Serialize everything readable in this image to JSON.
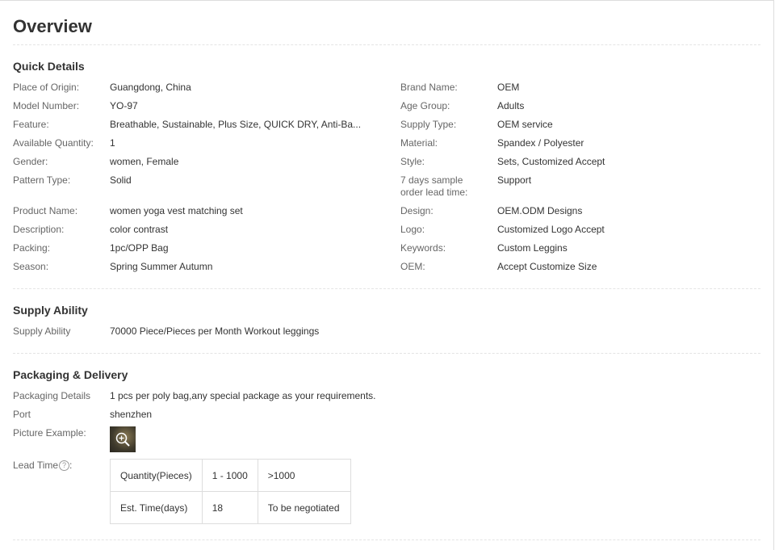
{
  "page": {
    "title": "Overview"
  },
  "quick_details": {
    "heading": "Quick Details",
    "left": [
      {
        "label": "Place of Origin:",
        "value": "Guangdong, China"
      },
      {
        "label": "Model Number:",
        "value": "YO-97"
      },
      {
        "label": "Feature:",
        "value": "Breathable, Sustainable, Plus Size, QUICK DRY, Anti-Ba..."
      },
      {
        "label": "Available Quantity:",
        "value": "1"
      },
      {
        "label": "Gender:",
        "value": "women, Female"
      },
      {
        "label": "Pattern Type:",
        "value": "Solid"
      },
      {
        "label": "Product Name:",
        "value": "women yoga vest matching set"
      },
      {
        "label": "Description:",
        "value": "color contrast"
      },
      {
        "label": "Packing:",
        "value": "1pc/OPP Bag"
      },
      {
        "label": "Season:",
        "value": "Spring Summer Autumn"
      }
    ],
    "right": [
      {
        "label": "Brand Name:",
        "value": "OEM"
      },
      {
        "label": "Age Group:",
        "value": "Adults"
      },
      {
        "label": "Supply Type:",
        "value": "OEM service"
      },
      {
        "label": "Material:",
        "value": "Spandex / Polyester"
      },
      {
        "label": "Style:",
        "value": "Sets, Customized Accept"
      },
      {
        "label": "7 days sample\norder lead time:",
        "value": "Support"
      },
      {
        "label": "Design:",
        "value": "OEM.ODM Designs"
      },
      {
        "label": "Logo:",
        "value": "Customized Logo Accept"
      },
      {
        "label": "Keywords:",
        "value": "Custom Leggins"
      },
      {
        "label": "OEM:",
        "value": "Accept Customize Size"
      }
    ]
  },
  "supply_ability": {
    "heading": "Supply Ability",
    "label": "Supply Ability",
    "value": "70000 Piece/Pieces per Month Workout leggings"
  },
  "packaging": {
    "heading": "Packaging & Delivery",
    "details_label": "Packaging Details",
    "details_value": "1 pcs per poly bag,any special package as your requirements.",
    "port_label": "Port",
    "port_value": "shenzhen",
    "picture_label": "Picture Example:",
    "lead_time_label": "Lead Time",
    "lead_time_suffix": ":",
    "help_icon": "question-circle-icon",
    "zoom_icon": "zoom-in-icon",
    "lead_table": {
      "rows": [
        [
          "Quantity(Pieces)",
          "1 - 1000",
          ">1000"
        ],
        [
          "Est. Time(days)",
          "18",
          "To be negotiated"
        ]
      ]
    }
  }
}
